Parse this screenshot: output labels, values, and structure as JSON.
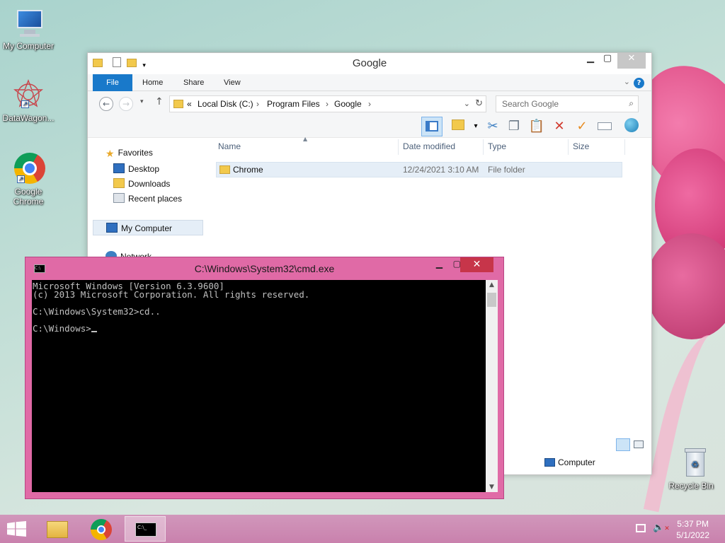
{
  "desktop": {
    "icons": [
      {
        "label": "My Computer"
      },
      {
        "label": "DataWagon..."
      },
      {
        "label": "Google Chrome"
      },
      {
        "label": "Recycle Bin"
      }
    ]
  },
  "explorer": {
    "title": "Google",
    "tabs": {
      "file": "File",
      "home": "Home",
      "share": "Share",
      "view": "View"
    },
    "address": {
      "prefix": "«",
      "crumbs": [
        "Local Disk (C:)",
        "Program Files",
        "Google"
      ]
    },
    "search_placeholder": "Search Google",
    "nav": {
      "favorites": "Favorites",
      "desktop": "Desktop",
      "downloads": "Downloads",
      "recent": "Recent places",
      "computer": "My Computer",
      "network": "Network"
    },
    "columns": {
      "name": "Name",
      "date": "Date modified",
      "type": "Type",
      "size": "Size"
    },
    "files": [
      {
        "name": "Chrome",
        "date": "12/24/2021 3:10 AM",
        "type": "File folder",
        "size": ""
      }
    ],
    "status_location": "Computer"
  },
  "cmd": {
    "title": "C:\\Windows\\System32\\cmd.exe",
    "lines": [
      "Microsoft Windows [Version 6.3.9600]",
      "(c) 2013 Microsoft Corporation. All rights reserved.",
      "",
      "C:\\Windows\\System32>cd..",
      "",
      "C:\\Windows>"
    ]
  },
  "taskbar": {
    "time": "5:37 PM",
    "date": "5/1/2022"
  },
  "colors": {
    "accent_file_tab": "#1979ca",
    "cmd_frame": "#e06aa6",
    "close_red": "#c7354a",
    "taskbar": "#cf8fb4"
  }
}
